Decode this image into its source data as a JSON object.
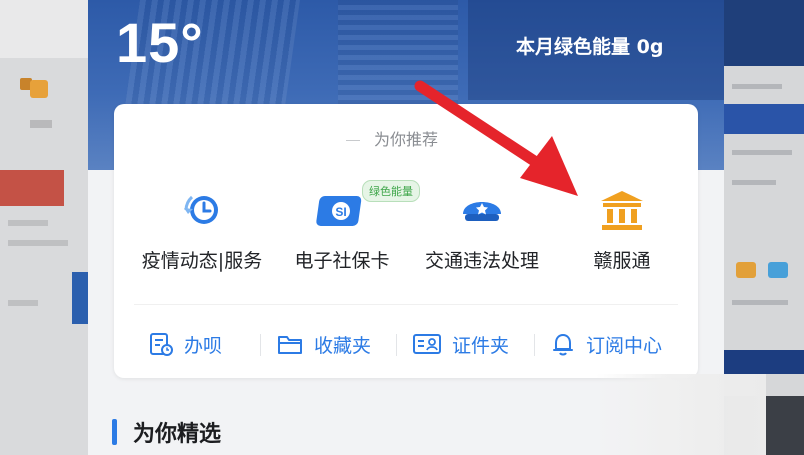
{
  "weather": {
    "temperature": "15°"
  },
  "header": {
    "green_energy": "本月绿色能量 0g"
  },
  "recommend": {
    "title": "为你推荐",
    "services": [
      {
        "label": "疫情动态|服务",
        "icon": "clock-refresh-icon"
      },
      {
        "label": "电子社保卡",
        "icon": "social-security-card-icon",
        "badge": "绿色能量"
      },
      {
        "label": "交通违法处理",
        "icon": "police-cap-icon"
      },
      {
        "label": "赣服通",
        "icon": "government-building-icon"
      }
    ]
  },
  "tools": [
    {
      "label": "办呗",
      "icon": "form-clock-icon"
    },
    {
      "label": "收藏夹",
      "icon": "folder-icon"
    },
    {
      "label": "证件夹",
      "icon": "id-card-icon"
    },
    {
      "label": "订阅中心",
      "icon": "bell-icon"
    }
  ],
  "section": {
    "title": "为你精选"
  },
  "colors": {
    "accent": "#2c7be5",
    "arrow": "#e5242b",
    "badge_green": "#3fa64a",
    "gov_orange": "#f0a020"
  }
}
